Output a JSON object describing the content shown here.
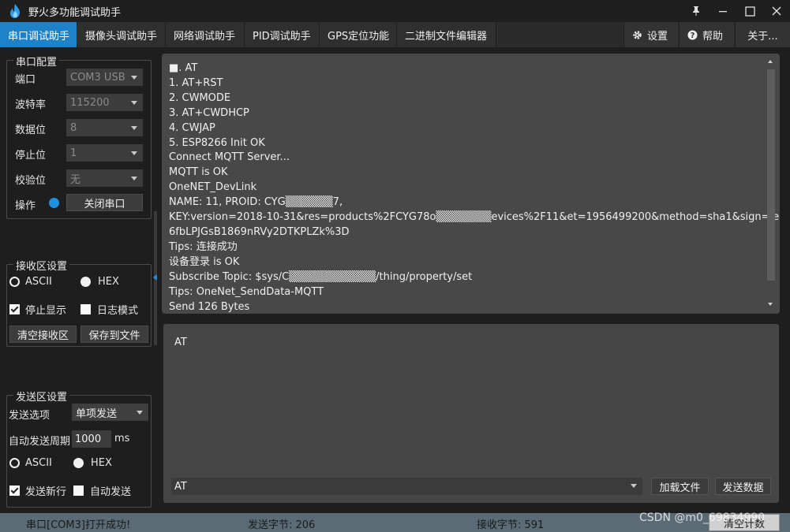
{
  "app": {
    "title": "野火多功能调试助手",
    "colors": {
      "accent": "#1e82c8",
      "status_dot": "#1e90e0"
    }
  },
  "tabs": [
    {
      "label": "串口调试助手",
      "active": true
    },
    {
      "label": "摄像头调试助手"
    },
    {
      "label": "网络调试助手"
    },
    {
      "label": "PID调试助手"
    },
    {
      "label": "GPS定位功能"
    },
    {
      "label": "二进制文件编辑器"
    }
  ],
  "right_tabs": {
    "settings": "设置",
    "help": "帮助",
    "about": "关于..."
  },
  "serial_config": {
    "title": "串口配置",
    "port_label": "端口",
    "port_value": "COM3 USB",
    "baud_label": "波特率",
    "baud_value": "115200",
    "databits_label": "数据位",
    "databits_value": "8",
    "stopbits_label": "停止位",
    "stopbits_value": "1",
    "parity_label": "校验位",
    "parity_value": "无",
    "operation_label": "操作",
    "close_port_button": "关闭串口"
  },
  "recv_settings": {
    "title": "接收区设置",
    "ascii_label": "ASCII",
    "hex_label": "HEX",
    "stop_display_label": "停止显示",
    "stop_display_checked": true,
    "log_mode_label": "日志模式",
    "log_mode_checked": false,
    "clear_button": "清空接收区",
    "save_button": "保存到文件"
  },
  "send_settings": {
    "title": "发送区设置",
    "option_label": "发送选项",
    "option_value": "单项发送",
    "period_label": "自动发送周期",
    "period_value": "1000",
    "period_unit": "ms",
    "ascii_label": "ASCII",
    "hex_label": "HEX",
    "newline_label": "发送新行",
    "newline_checked": true,
    "auto_send_label": "自动发送",
    "auto_send_checked": false
  },
  "receive_lines": [
    "■. AT",
    "1. AT+RST",
    "2. CWMODE",
    "3. AT+CWDHCP",
    "4. CWJAP",
    "5. ESP8266 Init OK",
    "Connect MQTT Server...",
    " MQTT is OK",
    "OneNET_DevLink",
    "NAME: 11,    PROID: CYG▒▒▒▒▒▒7,",
    "KEY:version=2018-10-31&res=products%2FCYG78o▒▒▒▒▒▒▒evices%2F11&et=1956499200&method=sha1&sign=le",
    "6fbLPJGsB1869nRVy2DTKPLZk%3D",
    "Tips:              连接成功",
    "设备登录 is OK",
    "Subscribe Topic: $sys/C▒▒▒▒▒▒▒▒▒▒▒/thing/property/set",
    "Tips:              OneNet_SendData-MQTT",
    "Send 126 Bytes"
  ],
  "send_area": {
    "text": "AT",
    "history_value": "AT",
    "load_file_button": "加载文件",
    "send_button": "发送数据"
  },
  "status_bar": {
    "message": "串口[COM3]打开成功!",
    "sent": "发送字节: 206",
    "received": "接收字节: 591",
    "clear_count_button": "清空计数"
  },
  "watermark": "CSDN @m0_69834990"
}
